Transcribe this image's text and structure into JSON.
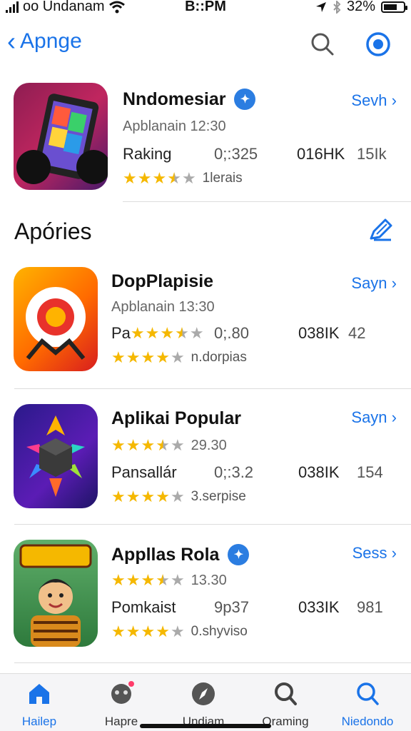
{
  "status": {
    "carrier": "oo Undanam",
    "time": "B::PM",
    "battery": "32%"
  },
  "nav": {
    "back_label": "Apnge"
  },
  "featured": {
    "title": "Nndomesiar",
    "subtitle": "Apblanain 12:30",
    "label": "Raking",
    "col1": "0;:325",
    "col2": "016HK",
    "col3": "15Ik",
    "rating_text": "1lerais",
    "action": "Sevh",
    "stars": 3.5
  },
  "section": {
    "title": "Apóries"
  },
  "apps": [
    {
      "title": "DopPlapisie",
      "subtitle": "Apblanain 13:30",
      "label": "Pa",
      "col1": "0;.80",
      "col2": "038IK",
      "col3": "42",
      "rating_text": "n.dorpias",
      "action": "Sayn",
      "stars_top": 3.5,
      "stars": 4
    },
    {
      "title": "Aplikai Popular",
      "subtitle": "29.30",
      "label": "Pansallár",
      "col1": "0;:3.2",
      "col2": "038IK",
      "col3": "154",
      "rating_text": "3.serpise",
      "action": "Sayn",
      "stars_top": 3.5,
      "stars": 4
    },
    {
      "title": "Appllas Rola",
      "subtitle": "13.30",
      "label": "Pomkaist",
      "col1": "9p37",
      "col2": "033IK",
      "col3": "981",
      "rating_text": "0.shyviso",
      "action": "Sess",
      "stars_top": 3.5,
      "stars": 4
    }
  ],
  "tabs": [
    {
      "label": "Hailep"
    },
    {
      "label": "Hapre"
    },
    {
      "label": "Undiam"
    },
    {
      "label": "Oraming"
    },
    {
      "label": "Niedondo"
    }
  ],
  "colors": {
    "accent": "#1a73e8",
    "star": "#f5b800"
  }
}
